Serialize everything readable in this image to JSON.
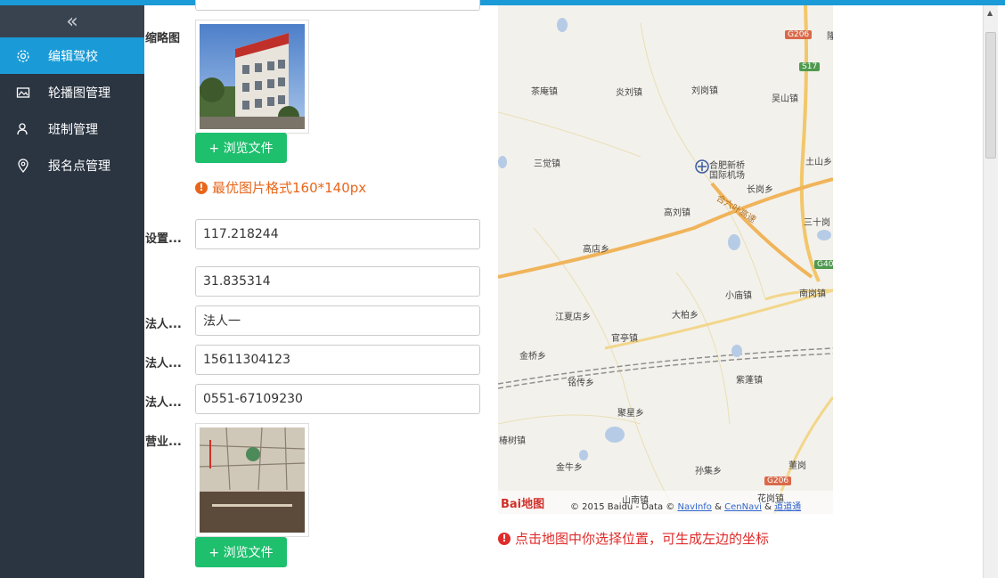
{
  "sidebar": {
    "collapse_icon": "double-chevron-left-icon",
    "items": [
      {
        "label": "编辑驾校",
        "icon": "gear-icon",
        "active": true
      },
      {
        "label": "轮播图管理",
        "icon": "image-icon",
        "active": false
      },
      {
        "label": "班制管理",
        "icon": "user-icon",
        "active": false
      },
      {
        "label": "报名点管理",
        "icon": "location-icon",
        "active": false
      }
    ]
  },
  "form": {
    "thumbnail_label": "缩略图",
    "browse_label": "+ 浏览文件",
    "thumbnail_hint": "最优图片格式160*140px",
    "location_label": "设置...",
    "longitude": "117.218244",
    "latitude": "31.835314",
    "legal_person_name_label": "法人...",
    "legal_person_name": "法人一",
    "legal_person_phone_label": "法人...",
    "legal_person_phone": "15611304123",
    "legal_person_tel_label": "法人...",
    "legal_person_tel": "0551-67109230",
    "license_label": "营业...",
    "license_browse_label": "+ 浏览文件"
  },
  "map": {
    "places": [
      "茶庵镇",
      "炎刘镇",
      "刘岗镇",
      "吴山镇",
      "三觉镇",
      "合肥新桥",
      "国际机场",
      "长岗乡",
      "土山乡",
      "高刘镇",
      "三十岗",
      "高店乡",
      "小庙镇",
      "南岗镇",
      "江夏店乡",
      "大柏乡",
      "官亭镇",
      "金桥乡",
      "铭传乡",
      "紫蓬镇",
      "聚星乡",
      "椿树镇",
      "金牛乡",
      "孙集乡",
      "董岗",
      "山南镇",
      "花岗镇",
      "隆"
    ],
    "road_badges": [
      "G206",
      "S17",
      "G40",
      "G206"
    ],
    "expressway": "合六叶高速",
    "logo": "Bai地图",
    "copyright": "© 2015 Baidu - Data ©",
    "link1": "NavInfo",
    "amp1": "&",
    "link2": "CenNavi",
    "amp2": "&",
    "link3": "道道通"
  },
  "map_hint": "点击地图中你选择位置，可生成左边的坐标",
  "colors": {
    "accent": "#1a9bd7",
    "sidebar": "#2b3542",
    "button": "#1ebf6d",
    "warn": "#e8661b",
    "error": "#e02b2b"
  }
}
